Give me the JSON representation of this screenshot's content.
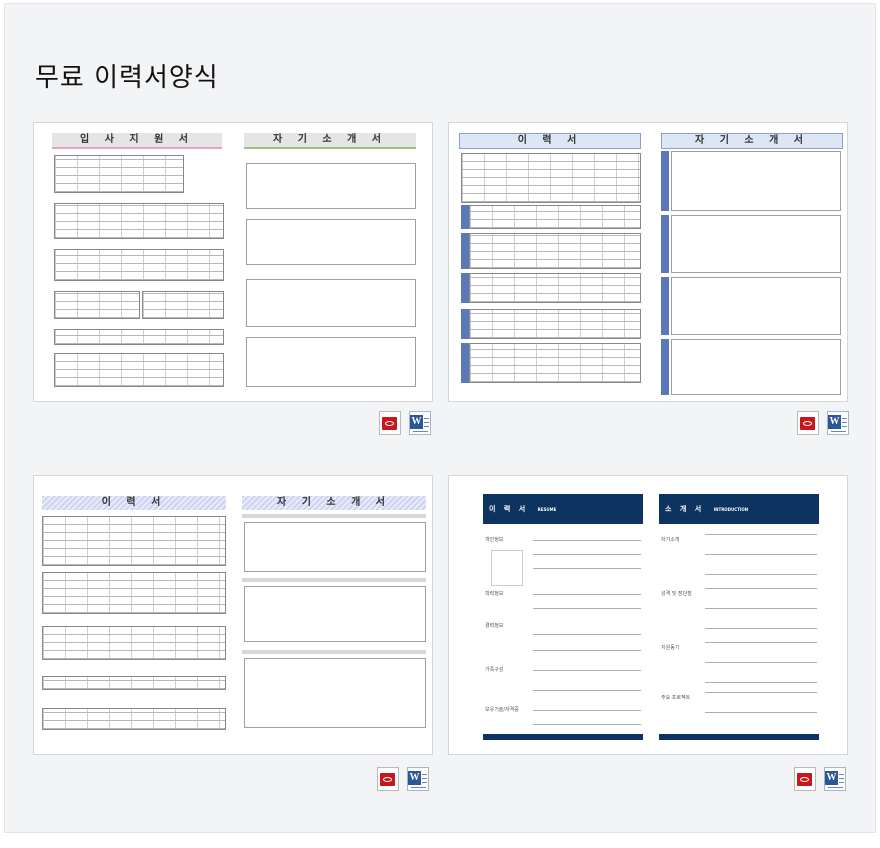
{
  "page": {
    "title": "무료 이력서양식"
  },
  "templates": [
    {
      "left_title": "입 사 지 원 서",
      "right_title": "자 기 소 개 서",
      "pdf_icon": "pdf-icon",
      "word_icon": "word-doc-icon"
    },
    {
      "left_title": "이 력 서",
      "right_title": "자 기 소 개 서",
      "pdf_icon": "pdf-icon",
      "word_icon": "word-doc-icon"
    },
    {
      "left_title": "이 력 서",
      "right_title": "자 기 소 개 서",
      "pdf_icon": "pdf-icon",
      "word_icon": "word-doc-icon"
    },
    {
      "left_title": "이 력 서",
      "left_subtitle": "RESUME",
      "right_title": "소 개 서",
      "right_subtitle": "INTRODUCTION",
      "pdf_icon": "pdf-icon",
      "word_icon": "word-doc-icon",
      "sections_left": [
        "개인정보",
        "학력정보",
        "경력정보",
        "가족구성",
        "보유기술/자격증"
      ],
      "sections_right": [
        "자기소개",
        "성격 및 장단점",
        "지원동기",
        "주요 프로젝트"
      ]
    }
  ],
  "icon_letters": {
    "word": "W"
  }
}
